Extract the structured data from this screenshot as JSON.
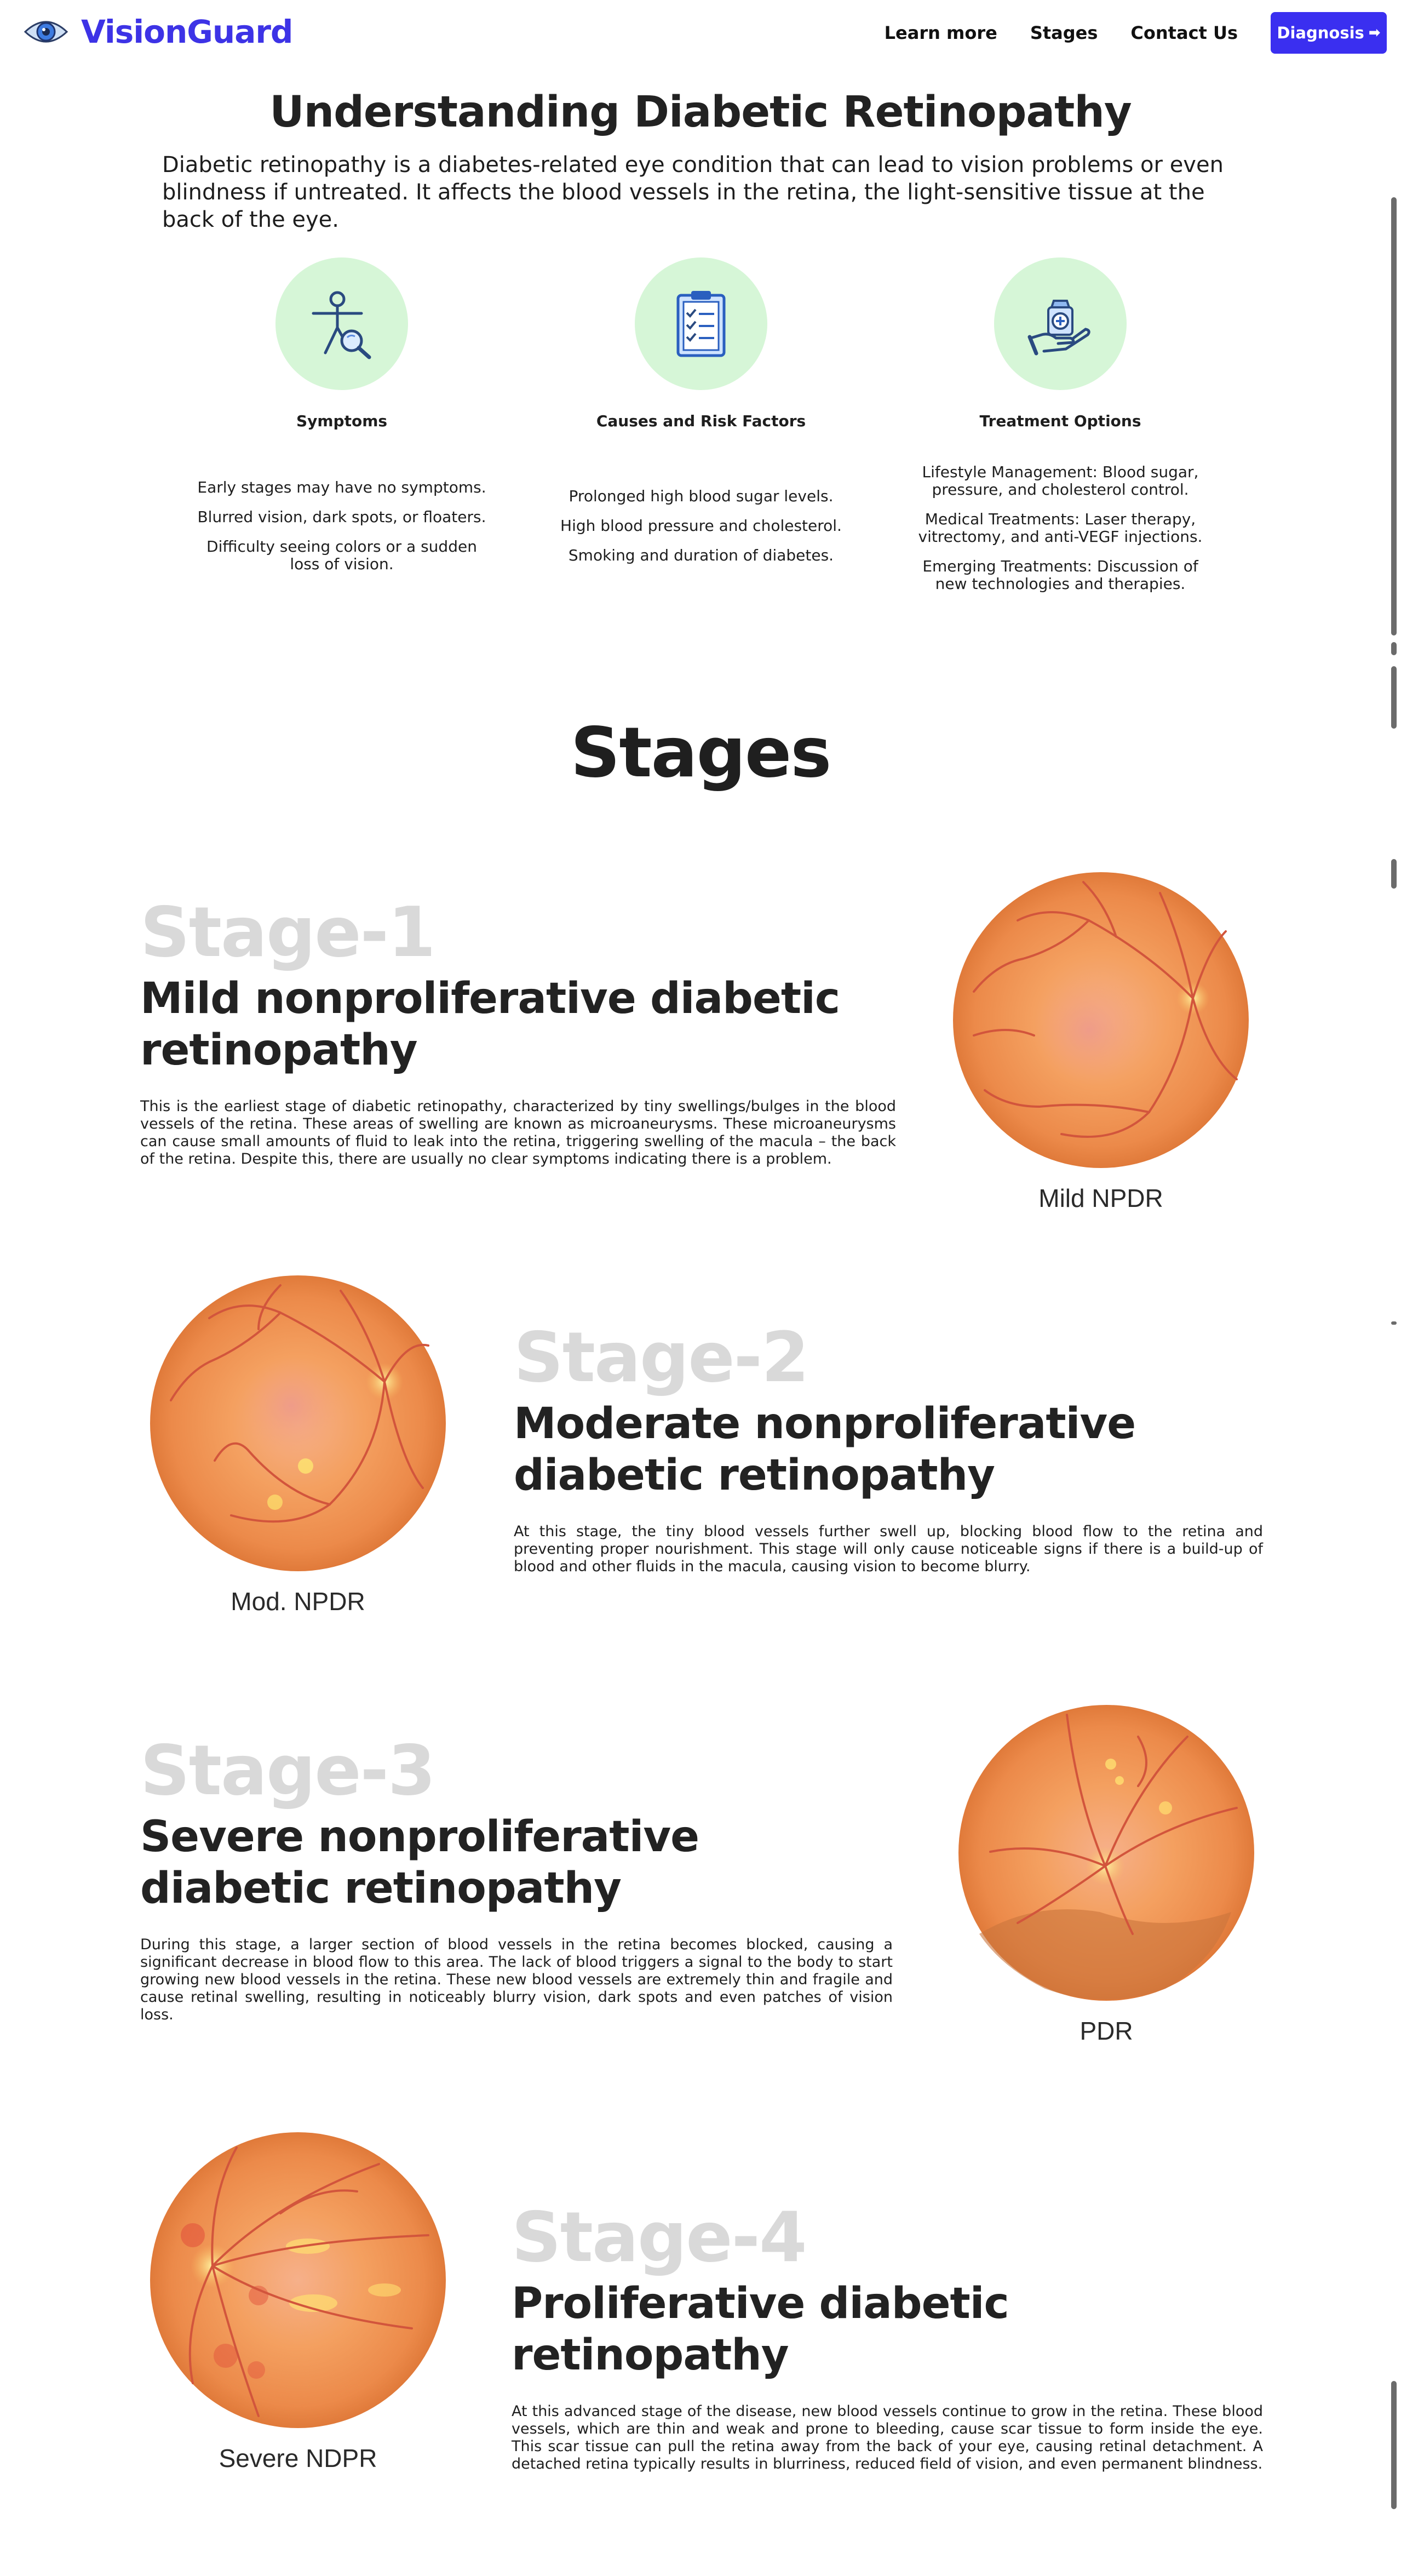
{
  "nav": {
    "brand": "VisionGuard",
    "links": [
      "Learn more",
      "Stages",
      "Contact Us"
    ],
    "cta": "Diagnosis",
    "cta_arrow": "➡"
  },
  "intro": {
    "title": "Understanding Diabetic Retinopathy",
    "text": "Diabetic retinopathy is a diabetes-related eye condition that can lead to vision problems or even blindness if untreated. It affects the blood vessels in the retina, the light-sensitive tissue at the back of the eye."
  },
  "cards": [
    {
      "title": "Symptoms",
      "icon": "person-search-icon",
      "items": [
        "Early stages may have no symptoms.",
        "Blurred vision, dark spots, or floaters.",
        "Difficulty seeing colors or a sudden loss of vision."
      ]
    },
    {
      "title": "Causes and Risk Factors",
      "icon": "clipboard-checklist-icon",
      "items": [
        "Prolonged high blood sugar levels.",
        "High blood pressure and cholesterol.",
        "Smoking and duration of diabetes."
      ]
    },
    {
      "title": "Treatment Options",
      "icon": "hand-medicine-icon",
      "items": [
        "Lifestyle Management: Blood sugar, pressure, and cholesterol control.",
        "Medical Treatments: Laser therapy, vitrectomy, and anti-VEGF injections.",
        "Emerging Treatments: Discussion of new technologies and therapies."
      ]
    }
  ],
  "stages_title": "Stages",
  "stages": [
    {
      "num": "Stage-1",
      "heading": "Mild nonproliferative diabetic retinopathy",
      "desc": "This is the earliest stage of diabetic retinopathy, characterized by tiny swellings/bulges in the blood vessels of the retina. These areas of swelling are known as microaneurysms. These microaneurysms can cause small amounts of fluid to leak into the retina, triggering swelling of the macula – the back of the retina. Despite this, there are usually no clear symptoms indicating there is a problem.",
      "image_label": "Mild NPDR"
    },
    {
      "num": "Stage-2",
      "heading": "Moderate nonproliferative diabetic retinopathy",
      "desc": "At this stage, the tiny blood vessels further swell up, blocking blood flow to the retina and preventing proper nourishment. This stage will only cause noticeable signs if there is a build-up of blood and other fluids in the macula, causing vision to become blurry.",
      "image_label": "Mod. NPDR"
    },
    {
      "num": "Stage-3",
      "heading": "Severe nonproliferative diabetic retinopathy",
      "desc": "During this stage, a larger section of blood vessels in the retina becomes blocked, causing a significant decrease in blood flow to this area. The lack of blood triggers a signal to the body to start growing new blood vessels in the retina. These new blood vessels are extremely thin and fragile and cause retinal swelling, resulting in noticeably blurry vision, dark spots and even patches of vision loss.",
      "image_label": "PDR"
    },
    {
      "num": "Stage-4",
      "heading": "Proliferative diabetic retinopathy",
      "desc": "At this advanced stage of the disease, new blood vessels continue to grow in the retina. These blood vessels, which are thin and weak and prone to bleeding, cause scar tissue to form inside the eye. This scar tissue can pull the retina away from the back of your eye, causing retinal detachment. A detached retina typically results in blurriness, reduced field of vision, and even permanent blindness.",
      "image_label": "Severe NDPR"
    }
  ],
  "colors": {
    "brand": "#3d33e6",
    "cta": "#3a2ff0",
    "icon_bg": "#d6f6d7",
    "stage_num": "#d9d9d9"
  }
}
